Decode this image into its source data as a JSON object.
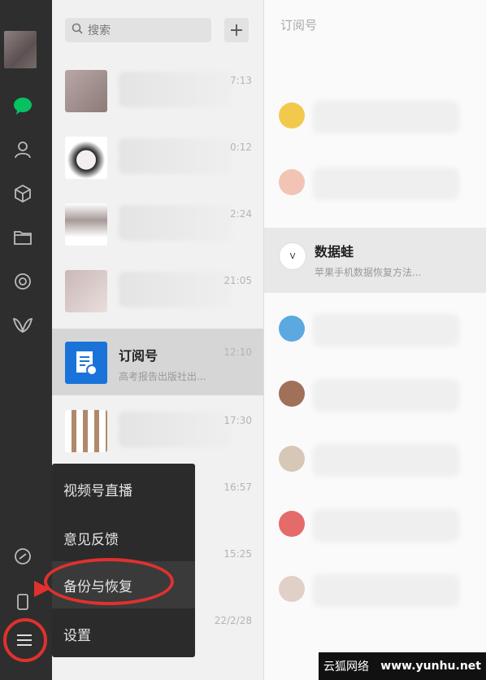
{
  "search": {
    "label": "搜索"
  },
  "add_button": {
    "label": "+"
  },
  "chats": [
    {
      "time": "7:13"
    },
    {
      "time": "0:12"
    },
    {
      "time": "2:24"
    },
    {
      "time": "21:05"
    },
    {
      "title": "订阅号",
      "time": "12:10",
      "sub": "高考报告出版社出..."
    },
    {
      "time": "17:30"
    },
    {
      "time": "16:57"
    },
    {
      "time": "15:25"
    },
    {
      "time": ""
    },
    {
      "time": "22/2/28"
    }
  ],
  "feed": {
    "header": "订阅号",
    "selected": {
      "name": "数据蛙",
      "sub": "苹果手机数据恢复方法..."
    }
  },
  "menu": {
    "items": [
      "视频号直播",
      "意见反馈",
      "备份与恢复",
      "设置"
    ]
  },
  "watermark": {
    "cn": "云狐网络",
    "url": "www.yunhu.net"
  },
  "colors": {
    "rail_bg": "#2e2e2e",
    "menu_bg": "#2b2b2b",
    "highlight_red": "#e0312e",
    "accent_green": "#07c160"
  }
}
